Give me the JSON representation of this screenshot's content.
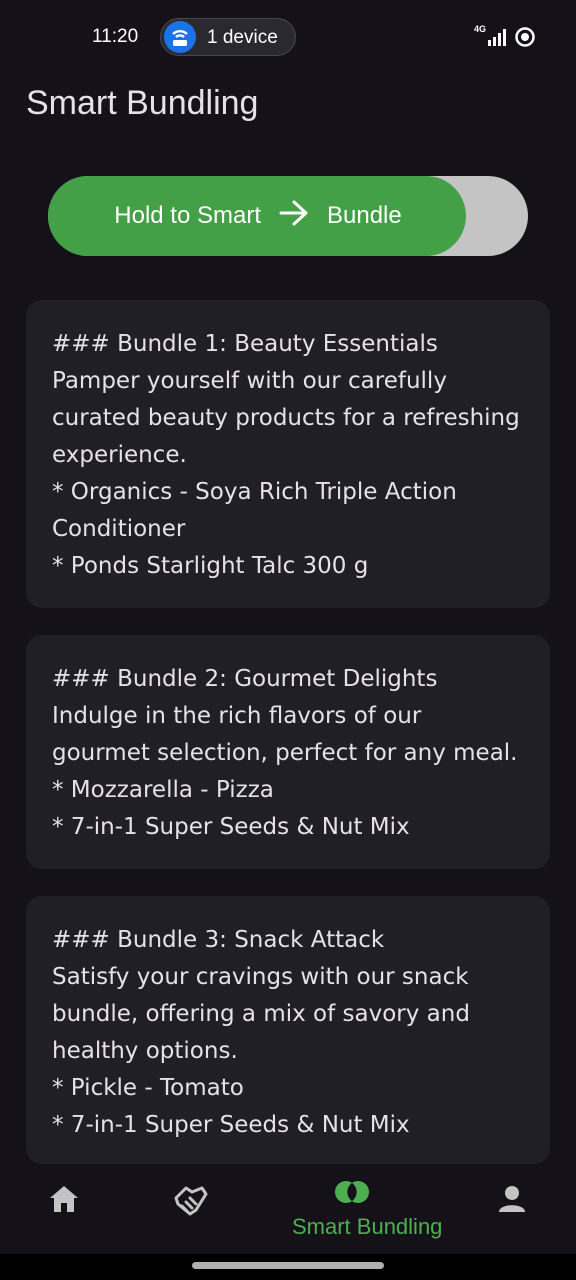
{
  "status_bar": {
    "time": "11:20",
    "device_chip": "1 device",
    "network": "4G"
  },
  "title": "Smart Bundling",
  "slider": {
    "label_left": "Hold to Smart",
    "label_right": "Bundle",
    "progress_percent": 87,
    "fill_color": "#43a047",
    "track_color": "#c4c4c4"
  },
  "bundles": [
    {
      "heading": "### Bundle 1: Beauty Essentials",
      "lines": [
        "Pamper yourself with our carefully",
        "curated beauty products for a refreshing",
        "experience.",
        "* Organics - Soya Rich Triple Action",
        "Conditioner",
        "* Ponds Starlight Talc 300 g"
      ]
    },
    {
      "heading": "### Bundle 2: Gourmet Delights",
      "lines": [
        "Indulge in the rich flavors of our",
        "gourmet selection, perfect for any meal.",
        "* Mozzarella - Pizza",
        "* 7-in-1 Super Seeds & Nut Mix"
      ]
    },
    {
      "heading": "### Bundle 3: Snack Attack",
      "lines": [
        "Satisfy your cravings with our snack",
        "bundle, offering a mix of savory and",
        "healthy options.",
        "* Pickle - Tomato",
        "* 7-in-1 Super Seeds & Nut Mix"
      ]
    }
  ],
  "nav": {
    "items": [
      {
        "icon": "home-icon"
      },
      {
        "icon": "handshake-icon"
      },
      {
        "icon": "smart-bundling-icon",
        "label": "Smart Bundling",
        "active": true
      },
      {
        "icon": "person-icon"
      }
    ],
    "active_color": "#4caf50"
  }
}
